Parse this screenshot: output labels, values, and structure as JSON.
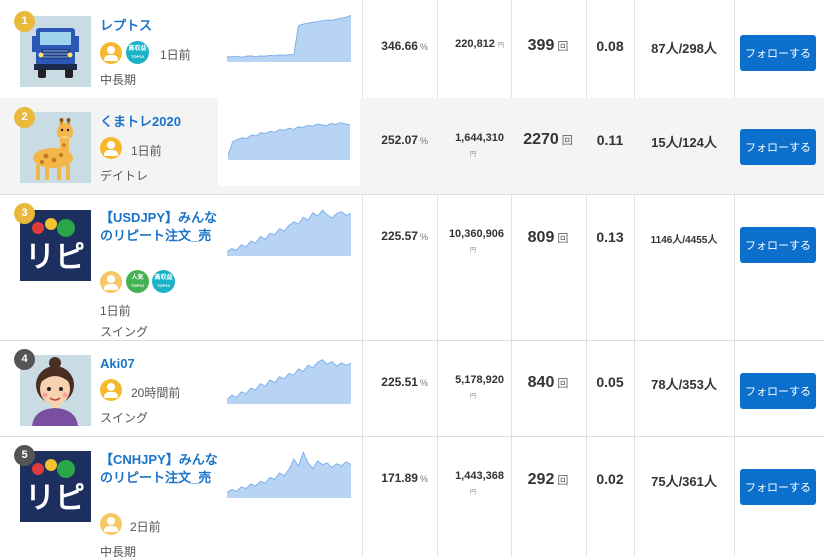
{
  "follow_label": "フォローする",
  "colors": {
    "link": "#1a73c8",
    "button": "#0d6fcc",
    "chart_fill": "#b7d4f5",
    "chart_line": "#7fb1ea",
    "rank_gold": "#e9b93b",
    "rank_dark": "#555555"
  },
  "traders": [
    {
      "rank": "1",
      "name": "レプトス",
      "time": "1日前",
      "style": "中長期",
      "return_value": "346.66",
      "return_unit": "%",
      "profit": "220,812",
      "profit_unit": "円",
      "trades": "399",
      "trades_unit": "回",
      "ratio": "0.08",
      "followers": "87人/298人",
      "avatar": "truck-avatar",
      "badges": [
        "user-icon",
        "high-profit-badge"
      ],
      "badge_text": {
        "high": "高収益",
        "top": "TOP10"
      },
      "equity": [
        0.07,
        0.07,
        0.08,
        0.06,
        0.08,
        0.09,
        0.07,
        0.09,
        0.08,
        0.1,
        0.09,
        0.11,
        0.1,
        0.12,
        0.11,
        0.75,
        0.78,
        0.8,
        0.82,
        0.83,
        0.85,
        0.87,
        0.86,
        0.89,
        0.91,
        0.93,
        0.97
      ]
    },
    {
      "rank": "2",
      "name": "くまトレ2020",
      "time": "1日前",
      "style": "デイトレ",
      "return_value": "252.07",
      "return_unit": "%",
      "profit": "1,644,310",
      "profit_unit": "円",
      "trades": "2270",
      "trades_unit": "回",
      "ratio": "0.11",
      "followers": "15人/124人",
      "avatar": "giraffe-avatar",
      "badges": [
        "user-icon"
      ],
      "equity": [
        0.05,
        0.35,
        0.4,
        0.44,
        0.42,
        0.5,
        0.48,
        0.55,
        0.53,
        0.58,
        0.56,
        0.62,
        0.6,
        0.65,
        0.62,
        0.68,
        0.66,
        0.71,
        0.69,
        0.74,
        0.72,
        0.7,
        0.75,
        0.73,
        0.77,
        0.74,
        0.72
      ]
    },
    {
      "rank": "3",
      "name": "【USDJPY】みんなのリピート注文_売",
      "time": "1日前",
      "style": "スイング",
      "return_value": "225.57",
      "return_unit": "%",
      "profit": "10,360,906",
      "profit_unit": "円",
      "trades": "809",
      "trades_unit": "回",
      "ratio": "0.13",
      "followers": "1146人/4455人",
      "avatar": "ripi-logo-avatar",
      "badges": [
        "multi-user-icon",
        "popular-badge",
        "high-profit-badge"
      ],
      "badge_text": {
        "popular": "人気",
        "high": "高収益",
        "top": "TOP10"
      },
      "equity": [
        0.05,
        0.12,
        0.08,
        0.2,
        0.15,
        0.28,
        0.24,
        0.38,
        0.32,
        0.45,
        0.42,
        0.55,
        0.5,
        0.62,
        0.7,
        0.65,
        0.8,
        0.74,
        0.9,
        0.82,
        0.95,
        0.85,
        0.78,
        0.88,
        0.92,
        0.84,
        0.88
      ]
    },
    {
      "rank": "4",
      "name": "Aki07",
      "time": "20時間前",
      "style": "スイング",
      "return_value": "225.51",
      "return_unit": "%",
      "profit": "5,178,920",
      "profit_unit": "円",
      "trades": "840",
      "trades_unit": "回",
      "ratio": "0.05",
      "followers": "78人/353人",
      "avatar": "woman-avatar",
      "badges": [
        "user-icon"
      ],
      "equity": [
        0.05,
        0.15,
        0.1,
        0.22,
        0.18,
        0.3,
        0.26,
        0.4,
        0.34,
        0.48,
        0.42,
        0.55,
        0.5,
        0.62,
        0.58,
        0.72,
        0.66,
        0.8,
        0.74,
        0.86,
        0.92,
        0.82,
        0.88,
        0.78,
        0.85,
        0.8,
        0.84
      ]
    },
    {
      "rank": "5",
      "name": "【CNHJPY】みんなのリピート注文_売",
      "time": "2日前",
      "style": "中長期",
      "return_value": "171.89",
      "return_unit": "%",
      "profit": "1,443,368",
      "profit_unit": "円",
      "trades": "292",
      "trades_unit": "回",
      "ratio": "0.02",
      "followers": "75人/361人",
      "avatar": "ripi-logo-avatar",
      "badges": [
        "multi-user-icon"
      ],
      "equity": [
        0.08,
        0.14,
        0.1,
        0.2,
        0.16,
        0.26,
        0.22,
        0.32,
        0.28,
        0.4,
        0.36,
        0.5,
        0.44,
        0.58,
        0.8,
        0.65,
        0.95,
        0.72,
        0.6,
        0.76,
        0.68,
        0.72,
        0.62,
        0.7,
        0.66,
        0.74,
        0.68
      ]
    }
  ]
}
